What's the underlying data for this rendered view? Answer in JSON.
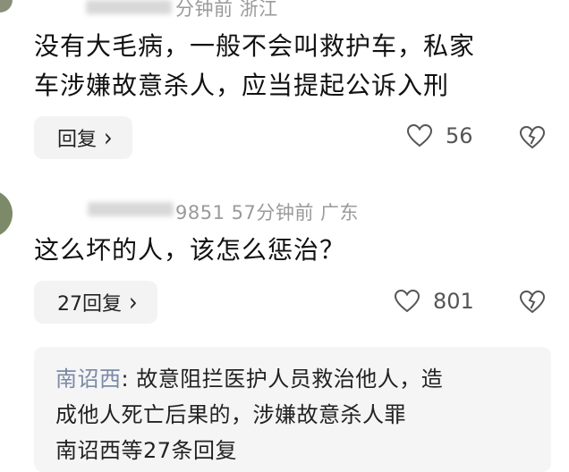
{
  "comments": [
    {
      "meta_tail": "分钟前  浙江",
      "lines": [
        "没有大毛病，一般不会叫救护车，私家",
        "车涉嫌故意杀人，应当提起公诉入刑"
      ],
      "reply_button": "回复",
      "likes": "56"
    },
    {
      "meta": "9851  57分钟前  广东",
      "lines": [
        "这么坏的人，该怎么惩治？"
      ],
      "reply_button": "27回复",
      "likes": "801",
      "sub_reply": {
        "author": "南诏西",
        "line1": ": 故意阻拦医护人员救治他人，造",
        "line2": "成他人死亡后果的，涉嫌故意杀人罪",
        "line3": "南诏西等27条回复"
      }
    }
  ],
  "icons": {
    "like": "heart-outline-icon",
    "dislike": "broken-heart-icon",
    "chevron": "chevron-right-icon"
  },
  "colors": {
    "meta_text": "#9a9a9a",
    "author_link": "#7a8aa8",
    "button_bg": "#f3f3f3"
  }
}
